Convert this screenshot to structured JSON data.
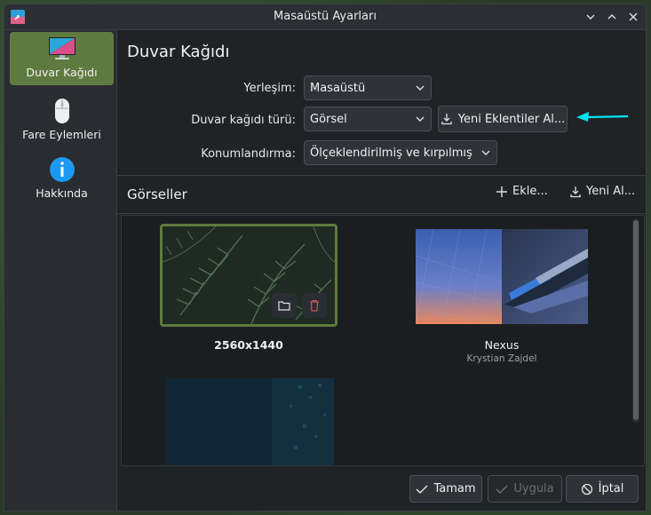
{
  "window": {
    "title": "Masaüstü Ayarları"
  },
  "sidebar": {
    "items": [
      {
        "label": "Duvar Kağıdı",
        "icon": "monitor-icon",
        "active": true
      },
      {
        "label": "Fare Eylemleri",
        "icon": "mouse-icon",
        "active": false
      },
      {
        "label": "Hakkında",
        "icon": "info-icon",
        "active": false
      }
    ]
  },
  "page": {
    "title": "Duvar Kağıdı"
  },
  "form": {
    "layout_label": "Yerleşim:",
    "layout_value": "Masaüstü",
    "type_label": "Duvar kağıdı türü:",
    "type_value": "Görsel",
    "get_plugins_label": "Yeni Eklentiler Al...",
    "positioning_label": "Konumlandırma:",
    "positioning_value": "Ölçeklendirilmiş ve kırpılmış"
  },
  "images_section": {
    "title": "Görseller",
    "add_label": "Ekle...",
    "get_new_label": "Yeni Al..."
  },
  "wallpapers": [
    {
      "name": "2560x1440",
      "author": "",
      "selected": true
    },
    {
      "name": "Nexus",
      "author": "Krystian Zajdel",
      "selected": false
    },
    {
      "name": "",
      "author": "",
      "selected": false
    }
  ],
  "footer": {
    "ok_label": "Tamam",
    "apply_label": "Uygula",
    "cancel_label": "İptal"
  },
  "colors": {
    "accent": "#5f7a3f",
    "arrow": "#00e5f0"
  }
}
